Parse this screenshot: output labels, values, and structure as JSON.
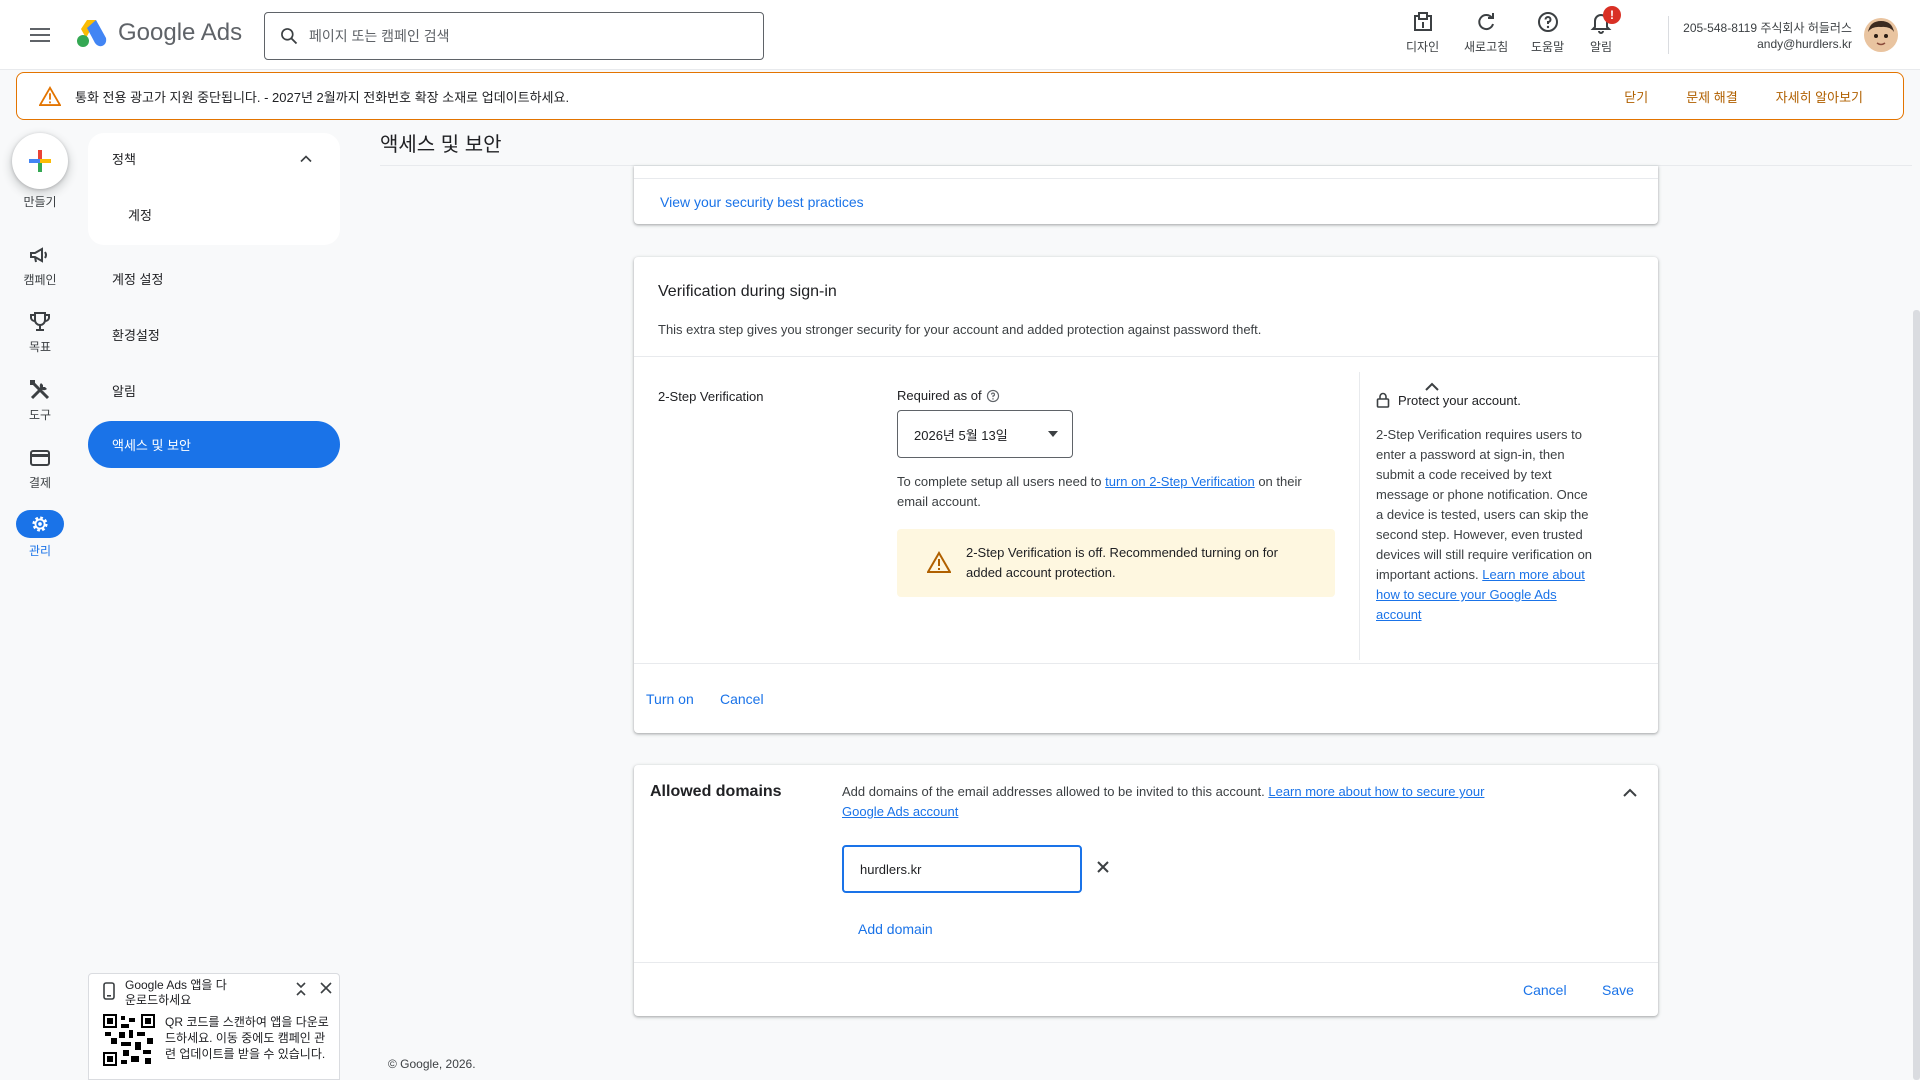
{
  "header": {
    "brand": "Google Ads",
    "search_placeholder": "페이지 또는 캠페인 검색",
    "tools": [
      {
        "label": "디자인",
        "icon": "appearance-icon"
      },
      {
        "label": "새로고침",
        "icon": "refresh-icon"
      },
      {
        "label": "도움말",
        "icon": "help-icon"
      },
      {
        "label": "알림",
        "icon": "bell-icon",
        "badge": "!"
      }
    ],
    "account_line1": "205-548-8119 주식회사 허들러스",
    "account_line2": "andy@hurdlers.kr"
  },
  "banner": {
    "text": "통화 전용 광고가 지원 중단됩니다. - 2027년 2월까지 전화번호 확장 소재로 업데이트하세요.",
    "actions": [
      "닫기",
      "문제 해결",
      "자세히 알아보기"
    ],
    "color": "#e37400"
  },
  "rail": {
    "items": [
      {
        "label": "만들기",
        "icon": "plus-icon"
      },
      {
        "label": "캠페인",
        "icon": "megaphone-icon"
      },
      {
        "label": "목표",
        "icon": "trophy-icon"
      },
      {
        "label": "도구",
        "icon": "tools-icon"
      },
      {
        "label": "결제",
        "icon": "credit-card-icon"
      },
      {
        "label": "관리",
        "icon": "gear-icon"
      }
    ]
  },
  "subnav": {
    "section": "정책",
    "section_child": "계정",
    "items": [
      "계정 설정",
      "환경설정",
      "알림"
    ],
    "active": "액세스 및 보안"
  },
  "page": {
    "title": "액세스 및 보안",
    "footer": "© Google, 2026."
  },
  "security_card": {
    "link": "View your security best practices"
  },
  "verification_card": {
    "title": "Verification during sign-in",
    "description": "This extra step gives you stronger security for your account and added protection against password theft.",
    "row_label": "2-Step Verification",
    "required_label": "Required as of",
    "selected_date": "2026년 5월 13일",
    "setup_prefix": "To complete setup all users need to ",
    "setup_link": "turn on 2-Step Verification",
    "setup_suffix": " on their email account.",
    "warning": "2-Step Verification is off. Recommended turning on for added account protection.",
    "side_title": "Protect your account.",
    "side_body": "2-Step Verification requires users to enter a password at sign-in, then submit a code received by text message or phone notification. Once a device is tested, users can skip the second step. However, even trusted devices will still require verification on important actions.",
    "side_link": "Learn more about how to secure your Google Ads account",
    "turn_on": "Turn on",
    "cancel": "Cancel"
  },
  "domains_card": {
    "title": "Allowed domains",
    "description": "Add domains of the email addresses allowed to be invited to this account. ",
    "description_link": "Learn more about how to secure your Google Ads account",
    "domain_value": "hurdlers.kr",
    "add_domain": "Add domain",
    "cancel": "Cancel",
    "save": "Save"
  },
  "qr_promo": {
    "title": "Google Ads 앱을 다운로드하세요",
    "body": "QR 코드를 스캔하여 앱을 다운로드하세요. 이동 중에도 캠페인 관련 업데이트를 받을 수 있습니다."
  },
  "colors": {
    "accent": "#1a73e8",
    "warning": "#f9ab00",
    "banner_border": "#e37400"
  }
}
